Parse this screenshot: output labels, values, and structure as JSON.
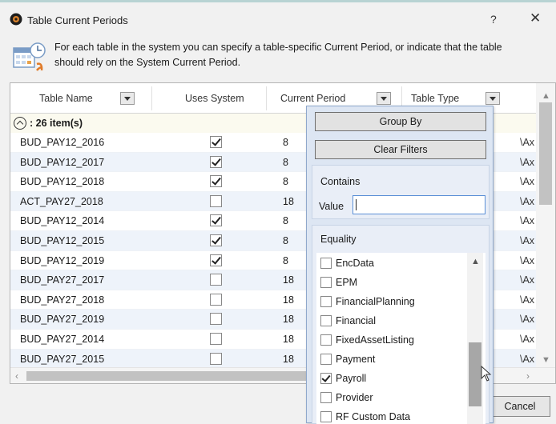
{
  "window": {
    "title": "Table Current Periods",
    "help_glyph": "?",
    "close_glyph": "✕",
    "app_icon": "app-gear-icon"
  },
  "info": {
    "icon": "calendar-clock-icon",
    "text_line1": "For each table in the system you can specify a table-specific Current Period, or indicate that the table",
    "text_line2": "should rely on the System Current Period."
  },
  "grid": {
    "columns": [
      "Table Name",
      "Uses System",
      "Current Period",
      "Table Type"
    ],
    "group_label": ": 26 item(s)",
    "rows": [
      {
        "name": "BUD_PAY12_2016",
        "uses_system": true,
        "period": "8",
        "type": "\\Ax"
      },
      {
        "name": "BUD_PAY12_2017",
        "uses_system": true,
        "period": "8",
        "type": "\\Ax"
      },
      {
        "name": "BUD_PAY12_2018",
        "uses_system": true,
        "period": "8",
        "type": "\\Ax"
      },
      {
        "name": "ACT_PAY27_2018",
        "uses_system": false,
        "period": "18",
        "type": "\\Ax"
      },
      {
        "name": "BUD_PAY12_2014",
        "uses_system": true,
        "period": "8",
        "type": "\\Ax"
      },
      {
        "name": "BUD_PAY12_2015",
        "uses_system": true,
        "period": "8",
        "type": "\\Ax"
      },
      {
        "name": "BUD_PAY12_2019",
        "uses_system": true,
        "period": "8",
        "type": "\\Ax"
      },
      {
        "name": "BUD_PAY27_2017",
        "uses_system": false,
        "period": "18",
        "type": "\\Ax"
      },
      {
        "name": "BUD_PAY27_2018",
        "uses_system": false,
        "period": "18",
        "type": "\\Ax"
      },
      {
        "name": "BUD_PAY27_2019",
        "uses_system": false,
        "period": "18",
        "type": "\\Ax"
      },
      {
        "name": "BUD_PAY27_2014",
        "uses_system": false,
        "period": "18",
        "type": "\\Ax"
      },
      {
        "name": "BUD_PAY27_2015",
        "uses_system": false,
        "period": "18",
        "type": "\\Ax"
      }
    ]
  },
  "filter_popup": {
    "group_by_label": "Group By",
    "clear_filters_label": "Clear Filters",
    "contains_title": "Contains",
    "value_label": "Value",
    "value_input": "",
    "equality_title": "Equality",
    "options": [
      {
        "label": "EncData",
        "checked": false
      },
      {
        "label": "EPM",
        "checked": false
      },
      {
        "label": "FinancialPlanning",
        "checked": false
      },
      {
        "label": "Financial",
        "checked": false
      },
      {
        "label": "FixedAssetListing",
        "checked": false
      },
      {
        "label": "Payment",
        "checked": false
      },
      {
        "label": "Payroll",
        "checked": true
      },
      {
        "label": "Provider",
        "checked": false
      },
      {
        "label": "RF Custom Data",
        "checked": false
      }
    ]
  },
  "footer": {
    "cancel_label": "Cancel"
  }
}
